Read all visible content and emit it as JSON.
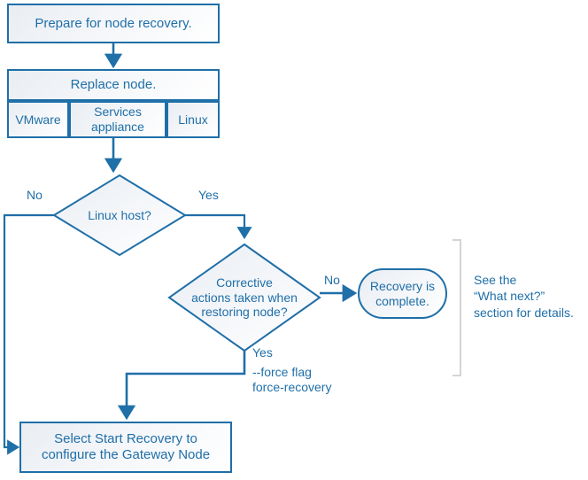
{
  "diagram": {
    "title": "Node recovery flowchart",
    "colors": {
      "stroke": "#1f6fa8",
      "text": "#1f6fa8",
      "fill_light": "#eef1f5",
      "bracket": "#d4d4d4"
    },
    "nodes": {
      "prepare": {
        "label": "Prepare for node recovery."
      },
      "replace": {
        "label": "Replace node."
      },
      "replace_options": [
        {
          "label": "VMware"
        },
        {
          "label": "Services\nappliance"
        },
        {
          "label": "Linux"
        }
      ],
      "linux_host_decision": {
        "label": "Linux host?"
      },
      "corrective_decision": {
        "label": "Corrective\nactions taken when\nrestoring node?"
      },
      "recovery_complete": {
        "label": "Recovery is\ncomplete."
      },
      "start_recovery": {
        "label": "Select Start Recovery to\nconfigure the Gateway Node"
      }
    },
    "edge_labels": {
      "linux_no": "No",
      "linux_yes": "Yes",
      "corrective_no": "No",
      "corrective_yes": "Yes",
      "force_flag": "--force flag\nforce-recovery"
    },
    "annotations": {
      "what_next": "See the\n“What next?”\nsection for details."
    }
  }
}
